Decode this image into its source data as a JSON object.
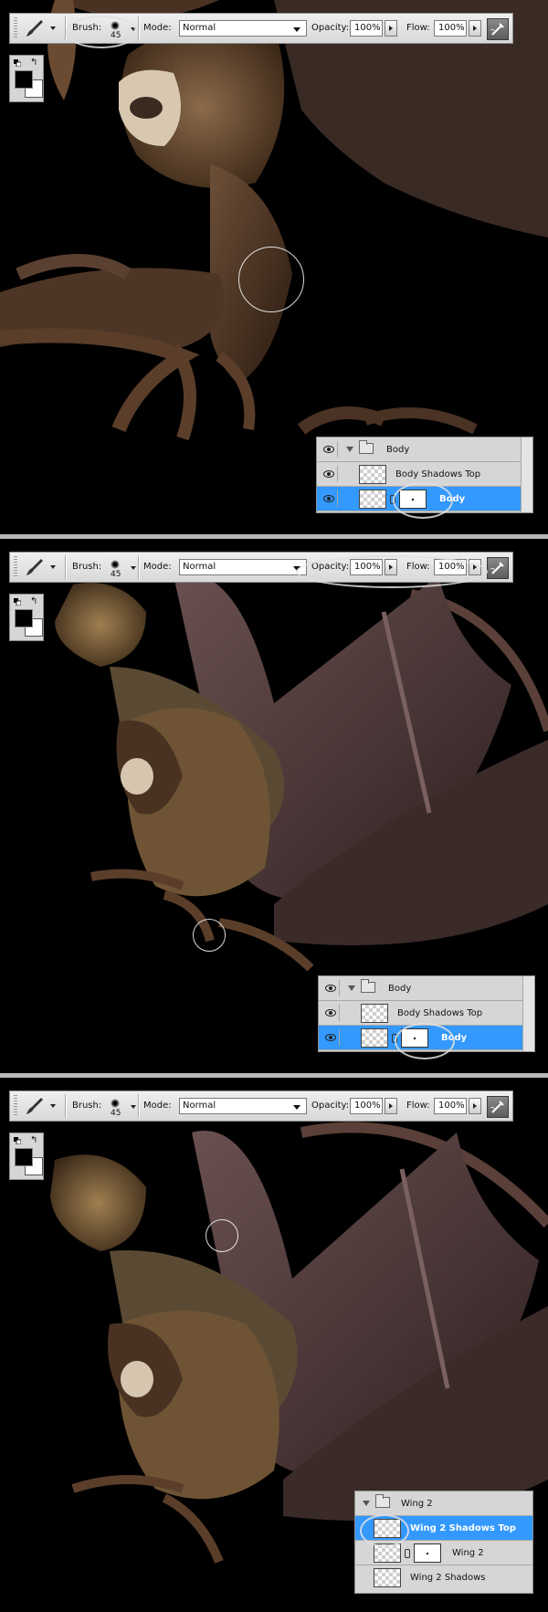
{
  "toolbar": {
    "brush_label": "Brush:",
    "brush_size": "45",
    "mode_label": "Mode:",
    "mode_value": "Normal",
    "opacity_label": "Opacity:",
    "opacity_value": "100%",
    "flow_label": "Flow:",
    "flow_value": "100%"
  },
  "swatch": {
    "swap_glyph": "↰"
  },
  "panels": [
    {
      "layers": [
        {
          "name": "Body",
          "type": "group"
        },
        {
          "name": "Body Shadows Top",
          "type": "layer"
        },
        {
          "name": "Body",
          "type": "masked-layer",
          "selected": true
        }
      ],
      "highlighted_control": "brush"
    },
    {
      "layers": [
        {
          "name": "Body",
          "type": "group"
        },
        {
          "name": "Body Shadows Top",
          "type": "layer"
        },
        {
          "name": "Body",
          "type": "masked-layer",
          "selected": true
        }
      ],
      "highlighted_control": "opacity-flow"
    },
    {
      "layers": [
        {
          "name": "Wing 2",
          "type": "group"
        },
        {
          "name": "Wing 2 Shadows Top",
          "type": "layer",
          "selected": true
        },
        {
          "name": "Wing 2",
          "type": "masked-layer"
        },
        {
          "name": "Wing 2 Shadows",
          "type": "layer"
        }
      ],
      "highlighted_control": "layer-thumbnail"
    }
  ],
  "colors": {
    "selection": "#3399ff",
    "panel_bg": "#d4d4d4",
    "canvas_bg": "#000000"
  }
}
